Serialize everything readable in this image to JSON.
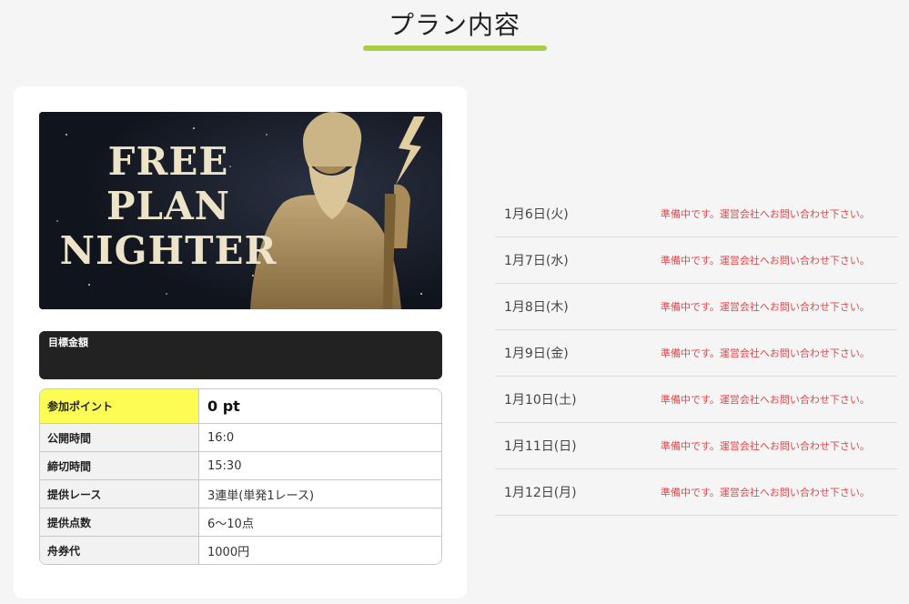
{
  "section": {
    "title": "プラン内容"
  },
  "banner": {
    "line1": "FREE",
    "line2": "PLAN",
    "line3": "NIGHTER"
  },
  "target": {
    "label": "目標金額"
  },
  "info": [
    {
      "key": "参加ポイント",
      "value": "0 pt"
    },
    {
      "key": "公開時間",
      "value": "16:0"
    },
    {
      "key": "締切時間",
      "value": "15:30"
    },
    {
      "key": "提供レース",
      "value": "3連単(単発1レース)"
    },
    {
      "key": "提供点数",
      "value": "6～10点"
    },
    {
      "key": "舟券代",
      "value": "1000円"
    }
  ],
  "schedule": [
    {
      "date": "1月6日(火)",
      "status": "準備中です。運営会社へお問い合わせ下さい。"
    },
    {
      "date": "1月7日(水)",
      "status": "準備中です。運営会社へお問い合わせ下さい。"
    },
    {
      "date": "1月8日(木)",
      "status": "準備中です。運営会社へお問い合わせ下さい。"
    },
    {
      "date": "1月9日(金)",
      "status": "準備中です。運営会社へお問い合わせ下さい。"
    },
    {
      "date": "1月10日(土)",
      "status": "準備中です。運営会社へお問い合わせ下さい。"
    },
    {
      "date": "1月11日(日)",
      "status": "準備中です。運営会社へお問い合わせ下さい。"
    },
    {
      "date": "1月12日(月)",
      "status": "準備中です。運営会社へお問い合わせ下さい。"
    }
  ],
  "colors": {
    "accent": "#a8cf45",
    "highlight": "#fdfc54",
    "status": "#e0474c"
  }
}
